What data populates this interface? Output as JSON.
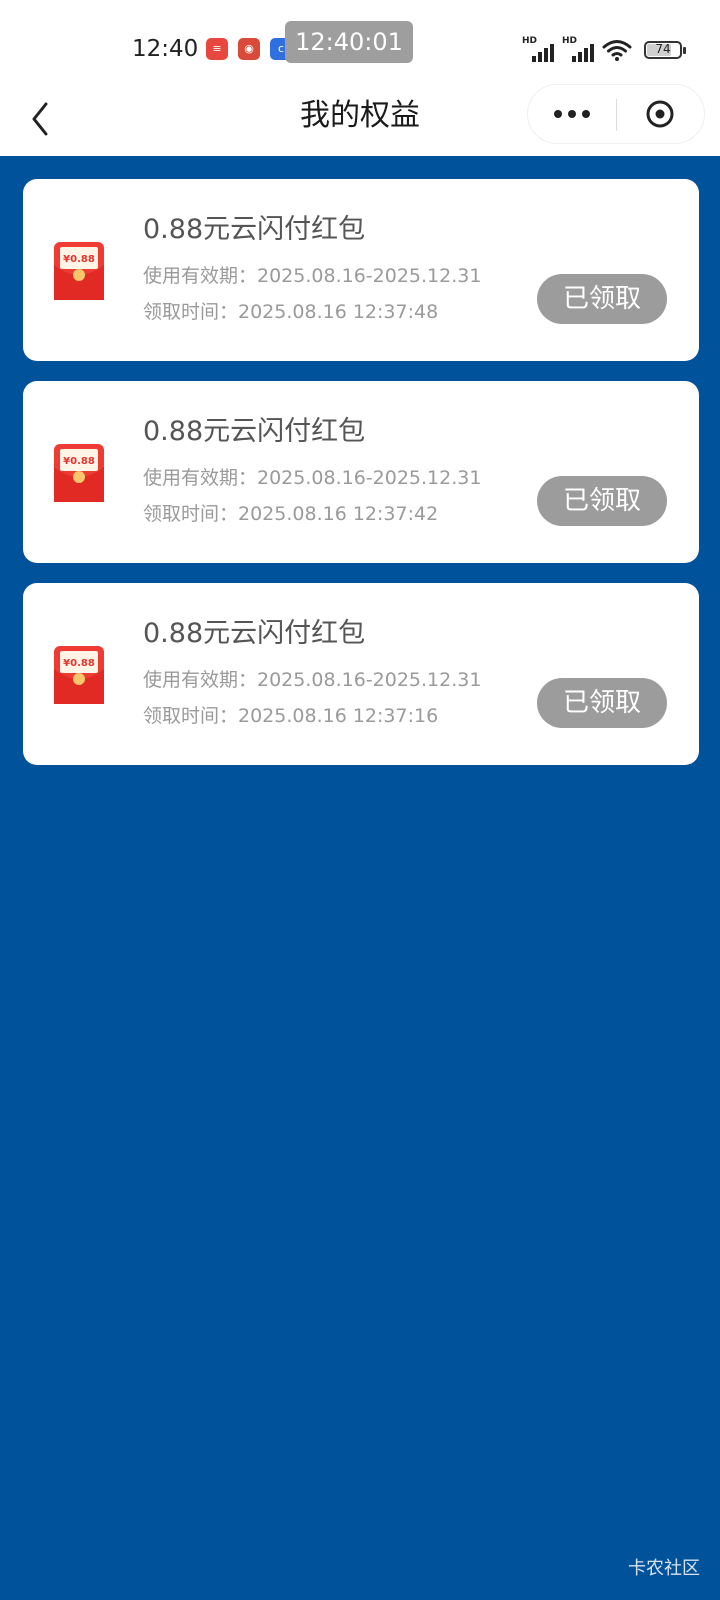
{
  "status_bar": {
    "time": "12:40",
    "clock_overlay": "12:40:01",
    "hd_label": "HD",
    "battery": "74",
    "battery_level": 0.74,
    "app_icons": [
      "red-app-icon",
      "red-app-icon",
      "blue-app-icon"
    ]
  },
  "nav": {
    "title": "我的权益",
    "back_icon": "chevron-left-icon",
    "more_icon": "more-dots-icon",
    "close_icon": "close-circle-icon"
  },
  "colors": {
    "background": "#00529b",
    "card": "#ffffff",
    "button_disabled": "#9c9c9c",
    "envelope_red": "#e8322f"
  },
  "envelope_label": "¥0.88",
  "benefits": [
    {
      "title": "0.88元云闪付红包",
      "validity": "使用有效期：2025.08.16-2025.12.31",
      "claim_time": "领取时间：2025.08.16 12:37:48",
      "button": "已领取"
    },
    {
      "title": "0.88元云闪付红包",
      "validity": "使用有效期：2025.08.16-2025.12.31",
      "claim_time": "领取时间：2025.08.16 12:37:42",
      "button": "已领取"
    },
    {
      "title": "0.88元云闪付红包",
      "validity": "使用有效期：2025.08.16-2025.12.31",
      "claim_time": "领取时间：2025.08.16 12:37:16",
      "button": "已领取"
    }
  ],
  "watermark": "卡农社区"
}
